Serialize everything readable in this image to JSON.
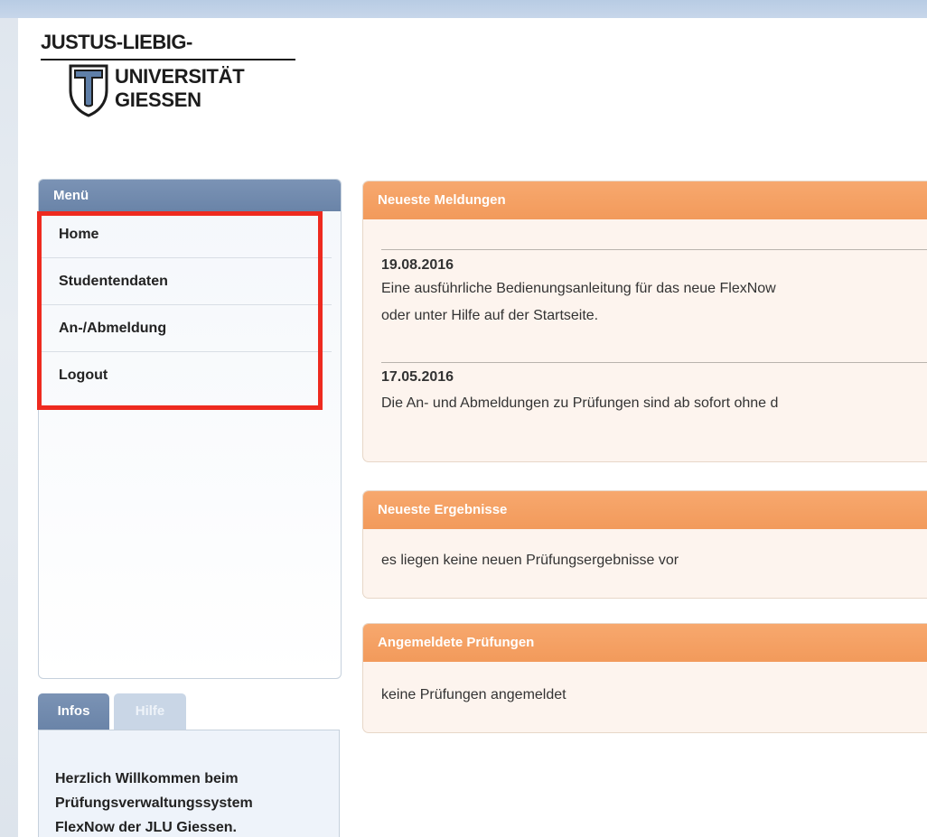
{
  "logo": {
    "line1": "JUSTUS-LIEBIG-",
    "line2": "UNIVERSITÄT",
    "line3": "GIESSEN",
    "icon": "jlu-t-shield-logo"
  },
  "menu": {
    "title": "Menü",
    "items": [
      {
        "label": "Home"
      },
      {
        "label": "Studentendaten"
      },
      {
        "label": "An-/Abmeldung"
      },
      {
        "label": "Logout"
      }
    ]
  },
  "info_tabs": {
    "tabs": [
      {
        "label": "Infos",
        "active": true
      },
      {
        "label": "Hilfe",
        "active": false
      }
    ],
    "text_line1": "Herzlich Willkommen beim",
    "text_line2": "Prüfungsverwaltungssystem",
    "text_line3": "FlexNow der JLU Giessen."
  },
  "news": {
    "title": "Neueste Meldungen",
    "entries": [
      {
        "date": "19.08.2016",
        "line1": "Eine ausführliche Bedienungsanleitung für das neue FlexNow",
        "line2": "oder unter Hilfe auf der Startseite."
      },
      {
        "date": "17.05.2016",
        "line1": "Die An- und Abmeldungen zu Prüfungen sind ab sofort ohne d"
      }
    ]
  },
  "results": {
    "title": "Neueste Ergebnisse",
    "text": "es liegen keine neuen Prüfungsergebnisse vor"
  },
  "registered": {
    "title": "Angemeldete Prüfungen",
    "text": "keine Prüfungen angemeldet"
  },
  "colors": {
    "menu_header": "#6a84a8",
    "panel_header": "#f29a5b",
    "panel_bg": "#fdf4ee",
    "highlight": "#ee2a1f"
  }
}
